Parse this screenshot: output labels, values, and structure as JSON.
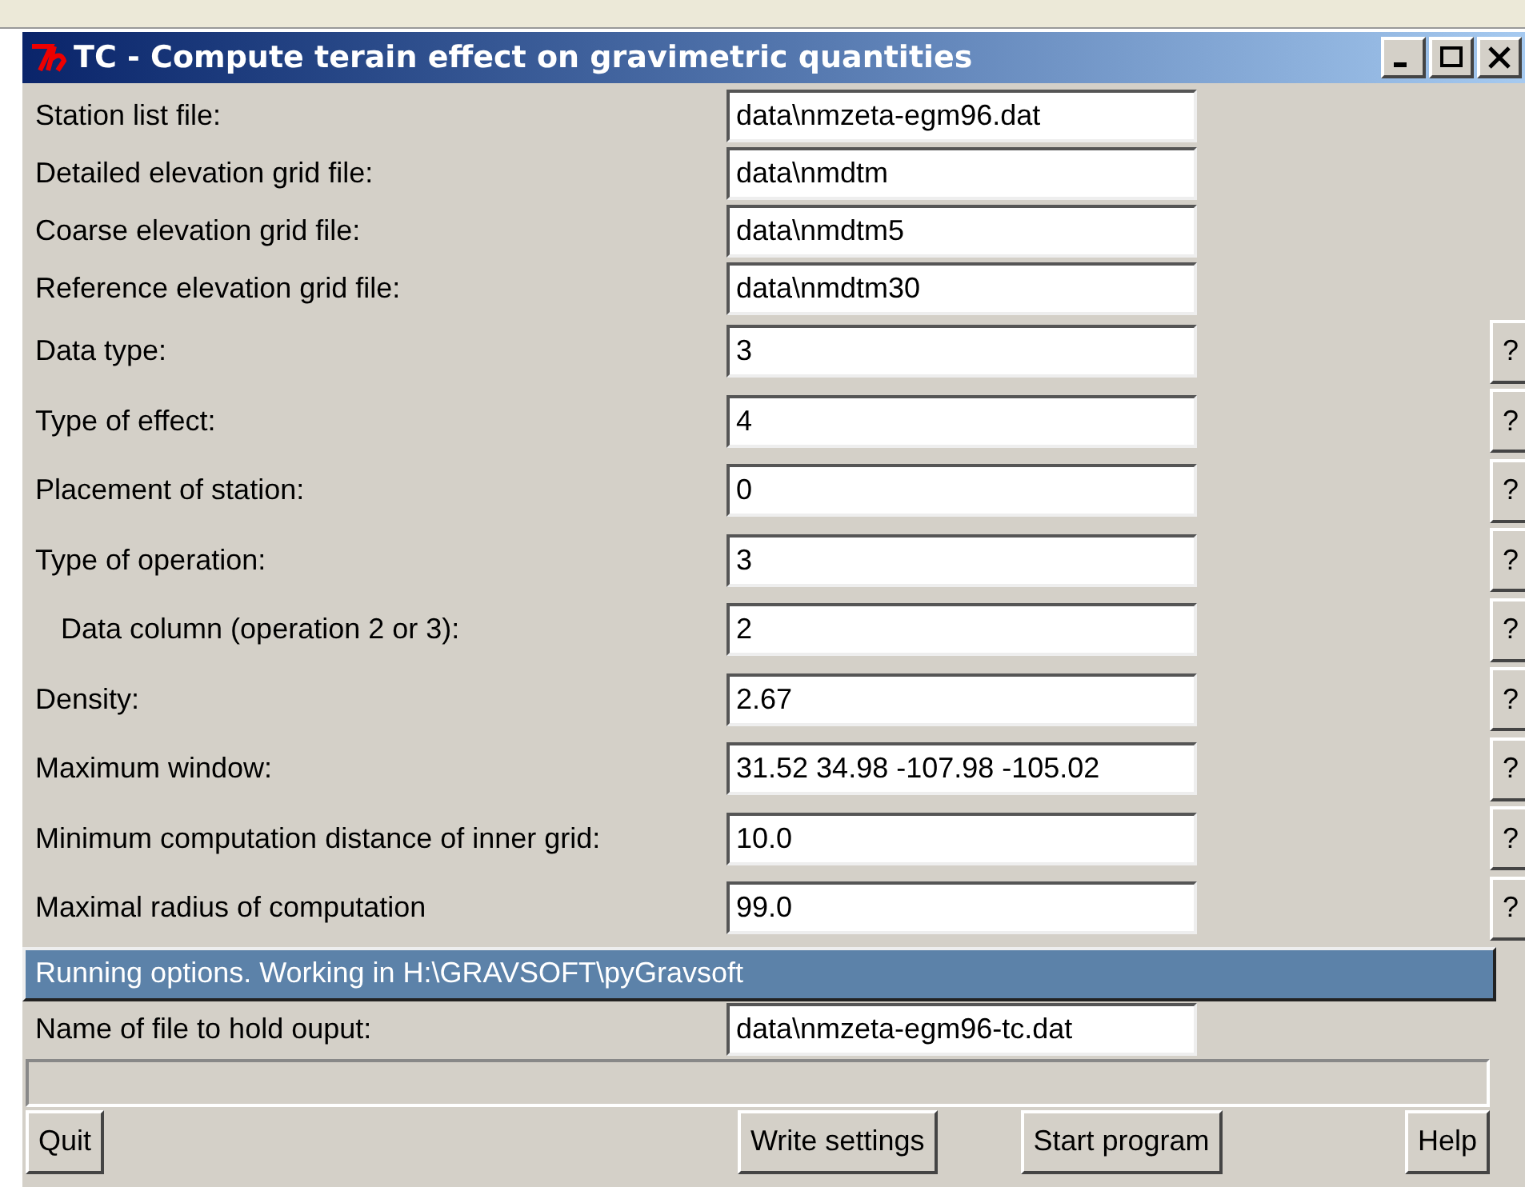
{
  "window": {
    "title": "TC - Compute terain effect on gravimetric quantities"
  },
  "fields": [
    {
      "label": "Station list file:",
      "value": "data\\nmzeta-egm96.dat",
      "indented": false
    },
    {
      "label": "Detailed elevation grid file:",
      "value": "data\\nmdtm",
      "indented": false
    },
    {
      "label": "Coarse elevation grid file:",
      "value": "data\\nmdtm5",
      "indented": false
    },
    {
      "label": "Reference elevation grid file:",
      "value": "data\\nmdtm30",
      "indented": false
    },
    {
      "label": "Data type:",
      "value": "3",
      "indented": false,
      "help": "?"
    },
    {
      "label": "Type of effect:",
      "value": "4",
      "indented": false,
      "help": "?"
    },
    {
      "label": "Placement of station:",
      "value": "0",
      "indented": false,
      "help": "?"
    },
    {
      "label": "Type of operation:",
      "value": "3",
      "indented": false,
      "help": "?"
    },
    {
      "label": "Data column (operation 2 or 3):",
      "value": "2",
      "indented": true,
      "help": "?"
    },
    {
      "label": "Density:",
      "value": "2.67",
      "indented": false,
      "help": "?"
    },
    {
      "label": "Maximum window:",
      "value": "31.52 34.98 -107.98 -105.02",
      "indented": false,
      "help": "?"
    },
    {
      "label": "Minimum computation distance of inner grid:",
      "value": "10.0",
      "indented": false,
      "help": "?"
    },
    {
      "label": "Maximal radius of computation",
      "value": "99.0",
      "indented": false,
      "help": "?"
    }
  ],
  "section": {
    "title": "Running options. Working in H:\\GRAVSOFT\\pyGravsoft"
  },
  "output": {
    "label": "Name of file to hold ouput:",
    "value": "data\\nmzeta-egm96-tc.dat"
  },
  "buttons": [
    "Quit",
    "Write settings",
    "Start program",
    "Help"
  ]
}
